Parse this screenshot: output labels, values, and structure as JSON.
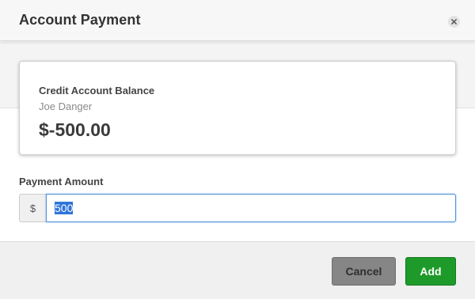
{
  "dialog": {
    "title": "Account Payment"
  },
  "balance": {
    "title": "Credit Account Balance",
    "customer_name": "Joe Danger",
    "amount": "$-500.00"
  },
  "payment": {
    "label": "Payment Amount",
    "currency_symbol": "$",
    "value": "500"
  },
  "actions": {
    "cancel_label": "Cancel",
    "add_label": "Add"
  },
  "colors": {
    "add_button": "#1e9a2a",
    "cancel_button": "#868686",
    "input_focus": "#4d90d8",
    "selection": "#3074d9"
  },
  "icons": {
    "close": "close-icon"
  }
}
